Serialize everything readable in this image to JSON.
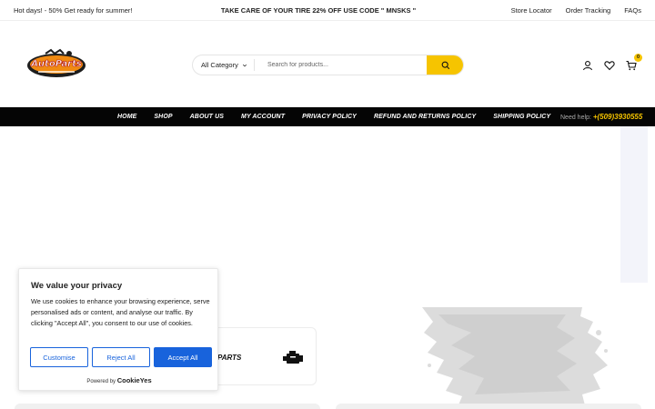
{
  "topbar": {
    "promo_left": "Hot days! - 50% Get ready for summer!",
    "promo_center": "TAKE CARE OF YOUR TIRE 22% OFF USE CODE \" MNSKS \"",
    "links": [
      "Store Locator",
      "Order Tracking",
      "FAQs"
    ]
  },
  "header": {
    "logo_text": "AutoParts",
    "search": {
      "category": "All Category",
      "placeholder": "Search for products..."
    },
    "cart_count": "0"
  },
  "nav": {
    "items": [
      "HOME",
      "SHOP",
      "ABOUT US",
      "MY ACCOUNT",
      "PRIVACY POLICY",
      "REFUND AND RETURNS POLICY",
      "SHIPPING POLICY"
    ],
    "help_label": "Need help:",
    "help_phone": "+(509)3930555"
  },
  "brand": {
    "parts_label": "PARTS"
  },
  "cookie": {
    "title": "We value your privacy",
    "body": "We use cookies to enhance your browsing experience, serve personalised ads or content, and analyse our traffic. By clicking \"Accept All\", you consent to our use of cookies.",
    "customise": "Customise",
    "reject": "Reject All",
    "accept": "Accept All",
    "powered_by": "Powered by",
    "powered_brand": "CookieYes"
  },
  "colors": {
    "accent": "#f6c400",
    "nav_bg": "#050505",
    "cookie_blue": "#1863dc"
  }
}
